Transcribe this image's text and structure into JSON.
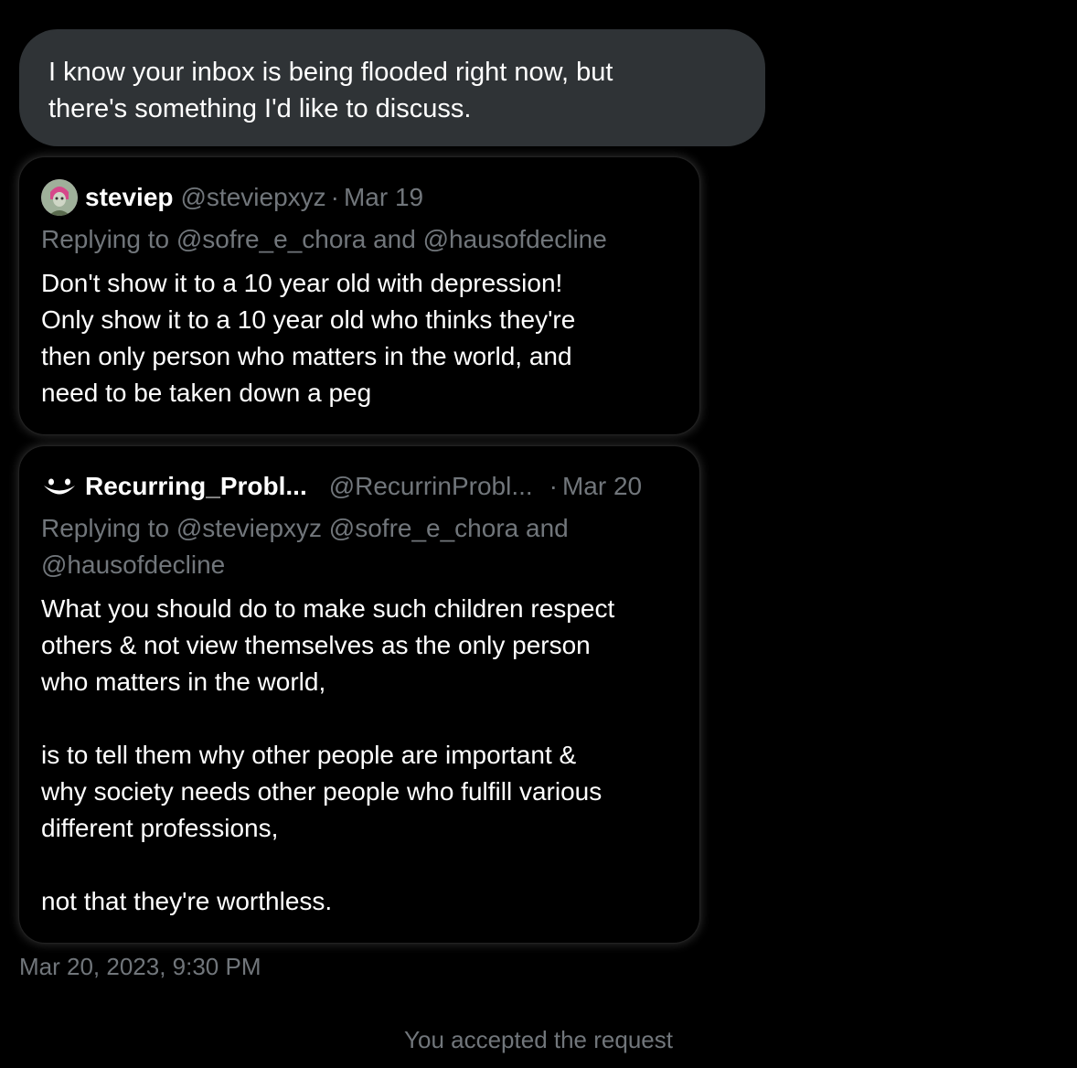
{
  "message": {
    "text": "I know your inbox is being flooded right now, but\nthere's something I'd like to discuss."
  },
  "tweets": [
    {
      "display_name": "steviep",
      "handle": "@steviepxyz",
      "separator": "·",
      "date": "Mar 19",
      "replying_prefix": "Replying to",
      "replying_to": "@sofre_e_chora and @hausofdecline",
      "body": "Don't show it to a 10 year old with depression!\nOnly show it to a 10 year old who thinks they're\nthen only person who matters in the world, and\nneed to be taken down a peg",
      "avatar_icon": "profile-avatar-icon"
    },
    {
      "display_name": "Recurring_Probl...",
      "handle": "@RecurrinProbl...",
      "separator": "·",
      "date": "Mar 20",
      "replying_prefix": "Replying to",
      "replying_to": "@steviepxyz @sofre_e_chora and\n@hausofdecline",
      "body": "What you should do to make such children respect\nothers & not view themselves as the only person\nwho matters in the world,\n\nis to tell them why other people are important &\nwhy society needs other people who fulfill various\ndifferent professions,\n\nnot that they're worthless.",
      "avatar_icon": "smiley-face-icon"
    }
  ],
  "timestamp": "Mar 20, 2023, 9:30 PM",
  "system_note": "You accepted the request",
  "colors": {
    "background": "#000000",
    "bubble": "#2f3336",
    "muted": "#71767b",
    "text": "#ffffff"
  }
}
